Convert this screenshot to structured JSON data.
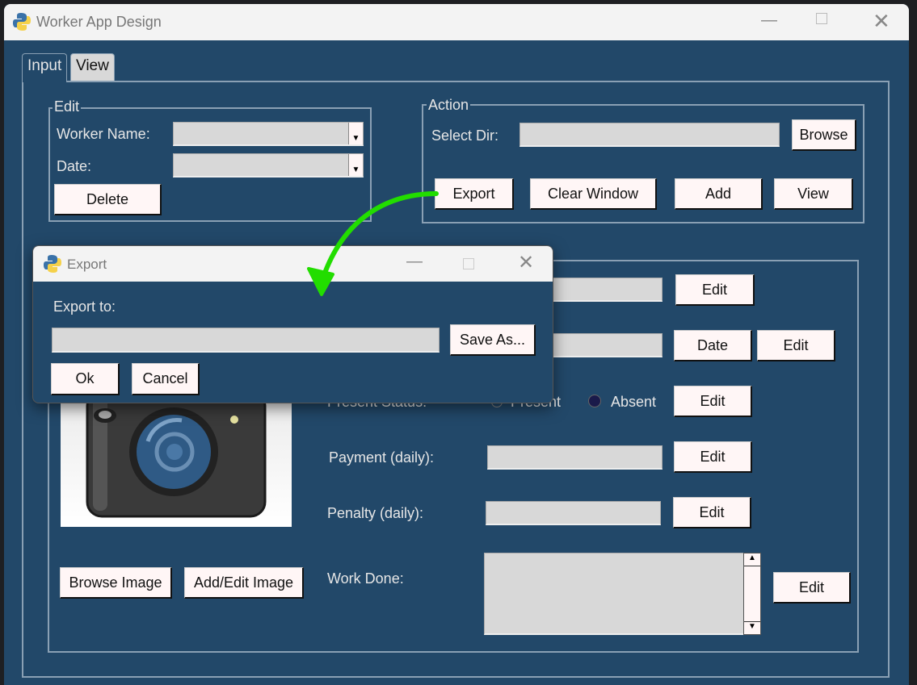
{
  "window": {
    "title": "Worker App Design",
    "icon": "python-icon",
    "controls": [
      "minimize",
      "maximize",
      "close"
    ]
  },
  "tabs": [
    {
      "label": "Input",
      "active": true
    },
    {
      "label": "View",
      "active": false
    }
  ],
  "edit_frame": {
    "title": "Edit",
    "worker_name_label": "Worker Name:",
    "worker_name_value": "",
    "date_label": "Date:",
    "date_value": "",
    "delete_label": "Delete"
  },
  "action_frame": {
    "title": "Action",
    "select_dir_label": "Select Dir:",
    "select_dir_value": "",
    "browse_label": "Browse",
    "export_label": "Export",
    "clear_label": "Clear Window",
    "add_label": "Add",
    "view_label": "View"
  },
  "details": {
    "edit_label": "Edit",
    "date_button": "Date",
    "present_status_label": "Present Status:",
    "present_option": "Present",
    "absent_option": "Absent",
    "selected_status": "Absent",
    "payment_label": "Payment (daily):",
    "penalty_label": "Penalty (daily):",
    "work_done_label": "Work Done:",
    "browse_image_label": "Browse Image",
    "add_edit_image_label": "Add/Edit Image",
    "image": "camera-image"
  },
  "export_dialog": {
    "title": "Export",
    "export_to_label": "Export to:",
    "export_to_value": "",
    "save_as_label": "Save As...",
    "ok_label": "Ok",
    "cancel_label": "Cancel"
  },
  "colors": {
    "background": "#224869",
    "button": "#fff6f6",
    "entry": "#d8d8d8",
    "annotation_arrow": "#22dd00"
  }
}
